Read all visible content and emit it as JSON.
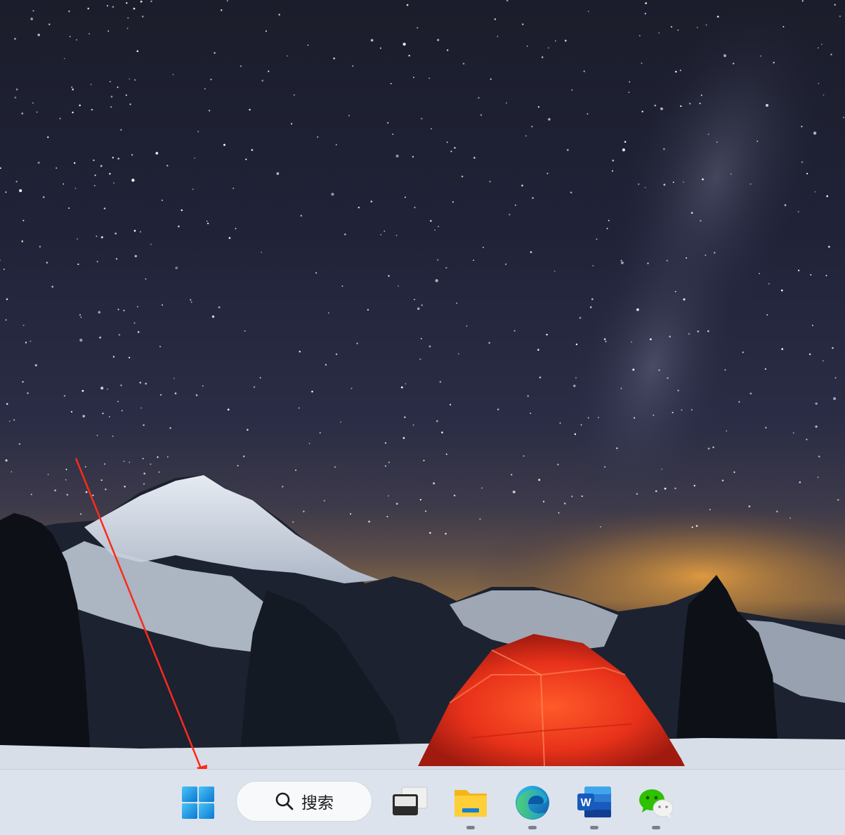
{
  "wallpaper": {
    "description_icon": "night-sky-mountain-tent-wallpaper",
    "tent_color": "#e8321a",
    "sky_color": "#1e2133"
  },
  "annotation": {
    "arrow_color": "#ff2a1a",
    "target": "start-button"
  },
  "taskbar": {
    "background": "#dde3ec",
    "start_icon": "windows-logo-icon",
    "search": {
      "label": "搜索",
      "icon": "search-icon"
    },
    "apps": [
      {
        "name": "task-view",
        "icon": "task-view-icon",
        "running": false
      },
      {
        "name": "file-explorer",
        "icon": "folder-icon",
        "running": true
      },
      {
        "name": "edge",
        "icon": "edge-icon",
        "running": true
      },
      {
        "name": "word",
        "icon": "word-icon",
        "letter": "W",
        "running": true
      },
      {
        "name": "wechat",
        "icon": "wechat-icon",
        "running": true
      }
    ]
  }
}
